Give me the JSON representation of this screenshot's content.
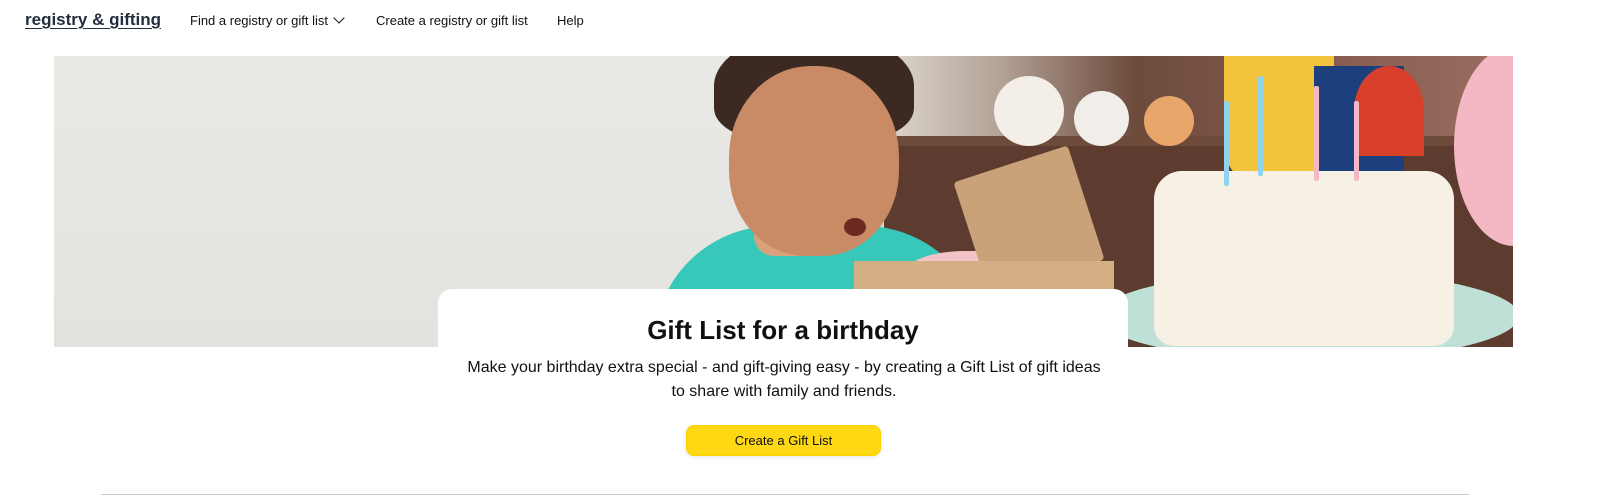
{
  "nav": {
    "brand": "registry & gifting",
    "find_label": "Find a registry or gift list",
    "create_label": "Create a registry or gift list",
    "help_label": "Help"
  },
  "hero": {
    "title": "Gift List for a birthday",
    "description": "Make your birthday extra special - and gift-giving easy - by creating a Gift List of gift ideas to share with family and friends.",
    "cta_label": "Create a Gift List"
  },
  "colors": {
    "cta": "#ffd814",
    "brand": "#232f3e"
  },
  "icons": {
    "find_dropdown": "chevron-down-icon"
  }
}
